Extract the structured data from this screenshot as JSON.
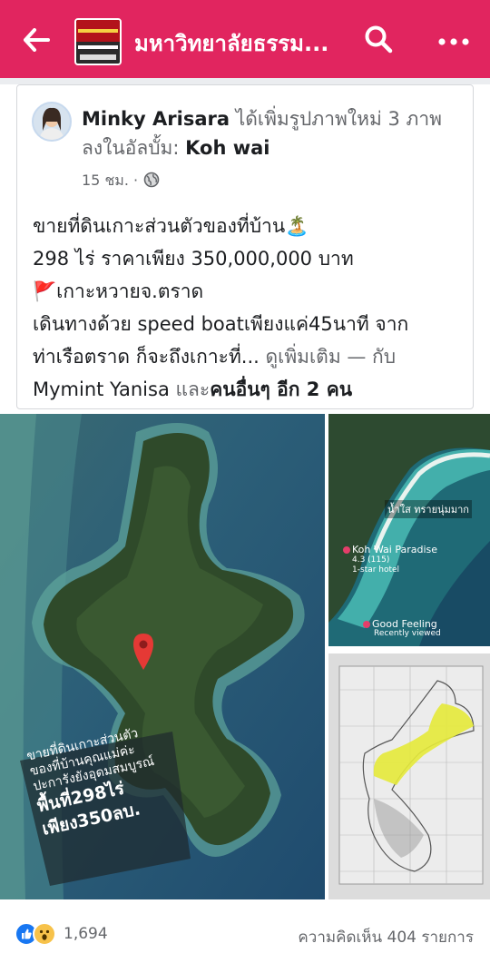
{
  "topbar": {
    "page_title": "มหาวิทยาลัยธรรม...",
    "bg_color": "#e1255f",
    "back_icon": "arrow-left-icon",
    "search_icon": "search-icon",
    "more_icon": "more-dots-icon"
  },
  "post": {
    "author": "Minky Arisara",
    "action_text": " ได้เพิ่มรูปภาพใหม่ 3 ภาพลงในอัลบั้ม: ",
    "album": "Koh wai",
    "time": "15 ชม. ·",
    "privacy_icon": "globe-icon",
    "text": {
      "line1": "ขายที่ดินเกาะส่วนตัวของที่บ้าน",
      "line1_emoji": "🏝️",
      "line2": "298 ไร่ ราคาเพียง 350,000,000 บาท",
      "line3_emoji": "🚩",
      "line3": "เกาะหวายจ.ตราด",
      "line4": "เดินทางด้วย speed boatเพียงแค่45นาที จาก",
      "line5_start": "ท่าเรือตราด ก็จะถึงเกาะที่...",
      "see_more": " ดูเพิ่มเติม",
      "with": " — กับ",
      "tagged_person": "Mymint Yanisa",
      "and_text": " และ",
      "others": "คนอื่นๆ อีก 2 คน"
    },
    "photos": {
      "main_caption_line1": "ขายที่ดินเกาะส่วนตัว",
      "main_caption_line2": "ของที่บ้านคุณแม่ค่ะ",
      "main_caption_line3": "ปะการังยังอุดมสมบูรณ์",
      "main_caption_line4": "พื้นที่298ไร่",
      "main_caption_line5": "เพียง350ลบ.",
      "top_right_label1": "น้ำใส ทรายนุ่มมาก",
      "top_right_label2": "Koh Wai Paradise",
      "top_right_label3": "4.3 (115)",
      "top_right_label4": "1-star hotel",
      "top_right_label5": "Good Feeling",
      "top_right_label6": "Recently viewed"
    },
    "reactions": {
      "count": "1,694",
      "icons": [
        "like-icon",
        "wow-icon"
      ]
    },
    "comments": "ความคิดเห็น 404 รายการ"
  }
}
